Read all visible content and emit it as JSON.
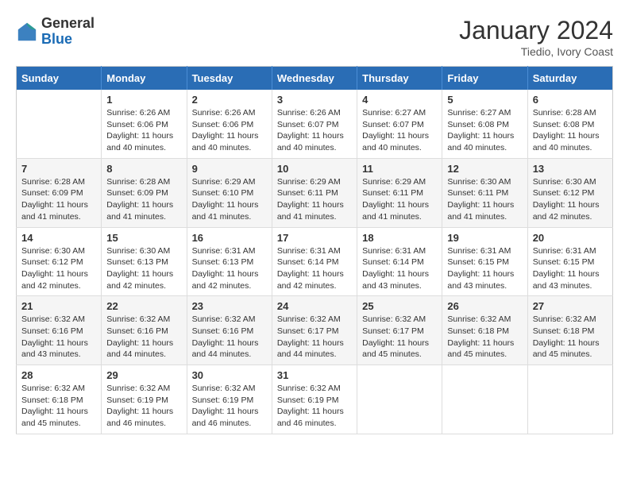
{
  "header": {
    "logo": {
      "general": "General",
      "blue": "Blue"
    },
    "title": "January 2024",
    "location": "Tiedio, Ivory Coast"
  },
  "days_of_week": [
    "Sunday",
    "Monday",
    "Tuesday",
    "Wednesday",
    "Thursday",
    "Friday",
    "Saturday"
  ],
  "weeks": [
    [
      {
        "day": "",
        "sunrise": "",
        "sunset": "",
        "daylight": ""
      },
      {
        "day": "1",
        "sunrise": "Sunrise: 6:26 AM",
        "sunset": "Sunset: 6:06 PM",
        "daylight": "Daylight: 11 hours and 40 minutes."
      },
      {
        "day": "2",
        "sunrise": "Sunrise: 6:26 AM",
        "sunset": "Sunset: 6:06 PM",
        "daylight": "Daylight: 11 hours and 40 minutes."
      },
      {
        "day": "3",
        "sunrise": "Sunrise: 6:26 AM",
        "sunset": "Sunset: 6:07 PM",
        "daylight": "Daylight: 11 hours and 40 minutes."
      },
      {
        "day": "4",
        "sunrise": "Sunrise: 6:27 AM",
        "sunset": "Sunset: 6:07 PM",
        "daylight": "Daylight: 11 hours and 40 minutes."
      },
      {
        "day": "5",
        "sunrise": "Sunrise: 6:27 AM",
        "sunset": "Sunset: 6:08 PM",
        "daylight": "Daylight: 11 hours and 40 minutes."
      },
      {
        "day": "6",
        "sunrise": "Sunrise: 6:28 AM",
        "sunset": "Sunset: 6:08 PM",
        "daylight": "Daylight: 11 hours and 40 minutes."
      }
    ],
    [
      {
        "day": "7",
        "sunrise": "Sunrise: 6:28 AM",
        "sunset": "Sunset: 6:09 PM",
        "daylight": "Daylight: 11 hours and 41 minutes."
      },
      {
        "day": "8",
        "sunrise": "Sunrise: 6:28 AM",
        "sunset": "Sunset: 6:09 PM",
        "daylight": "Daylight: 11 hours and 41 minutes."
      },
      {
        "day": "9",
        "sunrise": "Sunrise: 6:29 AM",
        "sunset": "Sunset: 6:10 PM",
        "daylight": "Daylight: 11 hours and 41 minutes."
      },
      {
        "day": "10",
        "sunrise": "Sunrise: 6:29 AM",
        "sunset": "Sunset: 6:11 PM",
        "daylight": "Daylight: 11 hours and 41 minutes."
      },
      {
        "day": "11",
        "sunrise": "Sunrise: 6:29 AM",
        "sunset": "Sunset: 6:11 PM",
        "daylight": "Daylight: 11 hours and 41 minutes."
      },
      {
        "day": "12",
        "sunrise": "Sunrise: 6:30 AM",
        "sunset": "Sunset: 6:11 PM",
        "daylight": "Daylight: 11 hours and 41 minutes."
      },
      {
        "day": "13",
        "sunrise": "Sunrise: 6:30 AM",
        "sunset": "Sunset: 6:12 PM",
        "daylight": "Daylight: 11 hours and 42 minutes."
      }
    ],
    [
      {
        "day": "14",
        "sunrise": "Sunrise: 6:30 AM",
        "sunset": "Sunset: 6:12 PM",
        "daylight": "Daylight: 11 hours and 42 minutes."
      },
      {
        "day": "15",
        "sunrise": "Sunrise: 6:30 AM",
        "sunset": "Sunset: 6:13 PM",
        "daylight": "Daylight: 11 hours and 42 minutes."
      },
      {
        "day": "16",
        "sunrise": "Sunrise: 6:31 AM",
        "sunset": "Sunset: 6:13 PM",
        "daylight": "Daylight: 11 hours and 42 minutes."
      },
      {
        "day": "17",
        "sunrise": "Sunrise: 6:31 AM",
        "sunset": "Sunset: 6:14 PM",
        "daylight": "Daylight: 11 hours and 42 minutes."
      },
      {
        "day": "18",
        "sunrise": "Sunrise: 6:31 AM",
        "sunset": "Sunset: 6:14 PM",
        "daylight": "Daylight: 11 hours and 43 minutes."
      },
      {
        "day": "19",
        "sunrise": "Sunrise: 6:31 AM",
        "sunset": "Sunset: 6:15 PM",
        "daylight": "Daylight: 11 hours and 43 minutes."
      },
      {
        "day": "20",
        "sunrise": "Sunrise: 6:31 AM",
        "sunset": "Sunset: 6:15 PM",
        "daylight": "Daylight: 11 hours and 43 minutes."
      }
    ],
    [
      {
        "day": "21",
        "sunrise": "Sunrise: 6:32 AM",
        "sunset": "Sunset: 6:16 PM",
        "daylight": "Daylight: 11 hours and 43 minutes."
      },
      {
        "day": "22",
        "sunrise": "Sunrise: 6:32 AM",
        "sunset": "Sunset: 6:16 PM",
        "daylight": "Daylight: 11 hours and 44 minutes."
      },
      {
        "day": "23",
        "sunrise": "Sunrise: 6:32 AM",
        "sunset": "Sunset: 6:16 PM",
        "daylight": "Daylight: 11 hours and 44 minutes."
      },
      {
        "day": "24",
        "sunrise": "Sunrise: 6:32 AM",
        "sunset": "Sunset: 6:17 PM",
        "daylight": "Daylight: 11 hours and 44 minutes."
      },
      {
        "day": "25",
        "sunrise": "Sunrise: 6:32 AM",
        "sunset": "Sunset: 6:17 PM",
        "daylight": "Daylight: 11 hours and 45 minutes."
      },
      {
        "day": "26",
        "sunrise": "Sunrise: 6:32 AM",
        "sunset": "Sunset: 6:18 PM",
        "daylight": "Daylight: 11 hours and 45 minutes."
      },
      {
        "day": "27",
        "sunrise": "Sunrise: 6:32 AM",
        "sunset": "Sunset: 6:18 PM",
        "daylight": "Daylight: 11 hours and 45 minutes."
      }
    ],
    [
      {
        "day": "28",
        "sunrise": "Sunrise: 6:32 AM",
        "sunset": "Sunset: 6:18 PM",
        "daylight": "Daylight: 11 hours and 45 minutes."
      },
      {
        "day": "29",
        "sunrise": "Sunrise: 6:32 AM",
        "sunset": "Sunset: 6:19 PM",
        "daylight": "Daylight: 11 hours and 46 minutes."
      },
      {
        "day": "30",
        "sunrise": "Sunrise: 6:32 AM",
        "sunset": "Sunset: 6:19 PM",
        "daylight": "Daylight: 11 hours and 46 minutes."
      },
      {
        "day": "31",
        "sunrise": "Sunrise: 6:32 AM",
        "sunset": "Sunset: 6:19 PM",
        "daylight": "Daylight: 11 hours and 46 minutes."
      },
      {
        "day": "",
        "sunrise": "",
        "sunset": "",
        "daylight": ""
      },
      {
        "day": "",
        "sunrise": "",
        "sunset": "",
        "daylight": ""
      },
      {
        "day": "",
        "sunrise": "",
        "sunset": "",
        "daylight": ""
      }
    ]
  ]
}
